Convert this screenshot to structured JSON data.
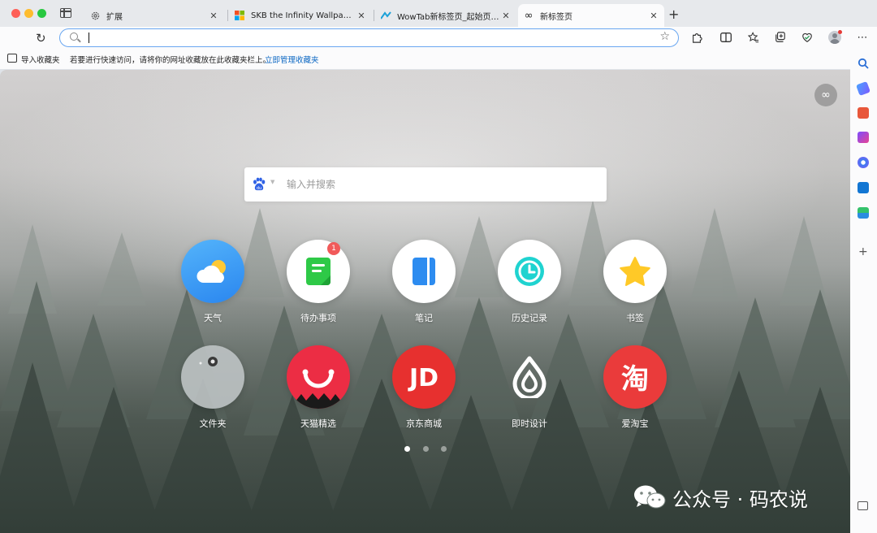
{
  "tabs": [
    {
      "title": "扩展",
      "active": false
    },
    {
      "title": "SKB the Infinity Wallpaper New",
      "active": false
    },
    {
      "title": "WowTab新标签页_起始页_微软",
      "active": false
    },
    {
      "title": "新标签页",
      "active": true
    }
  ],
  "address_bar": {
    "value": "",
    "placeholder": ""
  },
  "favorites_bar": {
    "import_label": "导入收藏夹",
    "hint": "若要进行快速访问，请将你的网址收藏放在此收藏夹栏上。",
    "manage_link": "立即管理收藏夹"
  },
  "search": {
    "placeholder": "输入并搜索",
    "engine_icon": "baidu-paw-icon"
  },
  "tiles": [
    {
      "label": "天气",
      "icon": "weather-icon",
      "color": "#3d9ff5"
    },
    {
      "label": "待办事项",
      "icon": "todo-icon",
      "color": "#ffffff",
      "badge": "1"
    },
    {
      "label": "笔记",
      "icon": "notes-icon",
      "color": "#ffffff"
    },
    {
      "label": "历史记录",
      "icon": "history-icon",
      "color": "#ffffff"
    },
    {
      "label": "书签",
      "icon": "bookmark-star-icon",
      "color": "#ffffff"
    },
    {
      "label": "文件夹",
      "icon": "folder-icon",
      "color": "#b7bcbc"
    },
    {
      "label": "天猫精选",
      "icon": "tmall-icon",
      "color": "#ec2d44"
    },
    {
      "label": "京东商城",
      "icon": "jd-icon",
      "color": "#e7302f"
    },
    {
      "label": "即时设计",
      "icon": "jishi-design-icon",
      "color": "transparent"
    },
    {
      "label": "爱淘宝",
      "icon": "taobao-icon",
      "color": "#ea3b3b"
    }
  ],
  "pagination": {
    "pages": 3,
    "current": 1
  },
  "watermark": {
    "text": "公众号 · 码农说",
    "icon": "wechat-icon"
  },
  "colors": {
    "accent": "#0a66c2",
    "omnibox_border": "#6aa7f1",
    "badge": "#f15a5a"
  }
}
